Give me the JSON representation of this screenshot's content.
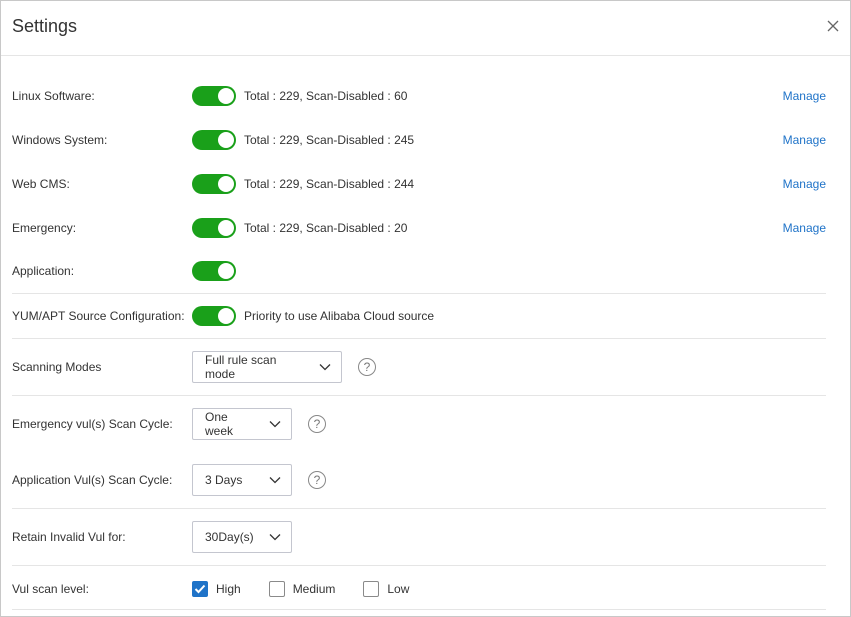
{
  "dialog": {
    "title": "Settings",
    "close_icon": "close-icon"
  },
  "switch_rows": [
    {
      "label": "Linux Software:",
      "enabled": true,
      "info": "Total : 229, Scan-Disabled : 60",
      "action": "Manage"
    },
    {
      "label": "Windows System:",
      "enabled": true,
      "info": "Total : 229, Scan-Disabled : 245",
      "action": "Manage"
    },
    {
      "label": "Web CMS:",
      "enabled": true,
      "info": "Total : 229, Scan-Disabled : 244",
      "action": "Manage"
    },
    {
      "label": "Emergency:",
      "enabled": true,
      "info": "Total : 229, Scan-Disabled : 20",
      "action": "Manage"
    },
    {
      "label": "Application:",
      "enabled": true
    }
  ],
  "yum_apt": {
    "label": "YUM/APT Source Configuration:",
    "enabled": true,
    "info": "Priority to use Alibaba Cloud source"
  },
  "scanning_modes": {
    "label": "Scanning Modes",
    "value": "Full rule scan mode",
    "help": "?"
  },
  "emergency_cycle": {
    "label": "Emergency vul(s) Scan Cycle:",
    "value": "One week",
    "help": "?"
  },
  "application_cycle": {
    "label": "Application Vul(s) Scan Cycle:",
    "value": "3 Days",
    "help": "?"
  },
  "retain_invalid": {
    "label": "Retain Invalid Vul for:",
    "value": "30Day(s)"
  },
  "scan_level": {
    "label": "Vul scan level:",
    "options": [
      {
        "label": "High",
        "checked": true
      },
      {
        "label": "Medium",
        "checked": false
      },
      {
        "label": "Low",
        "checked": false
      }
    ]
  },
  "colors": {
    "switch_on": "#1aa01a",
    "link": "#1f73c8",
    "checkbox_checked": "#1f73c8"
  }
}
